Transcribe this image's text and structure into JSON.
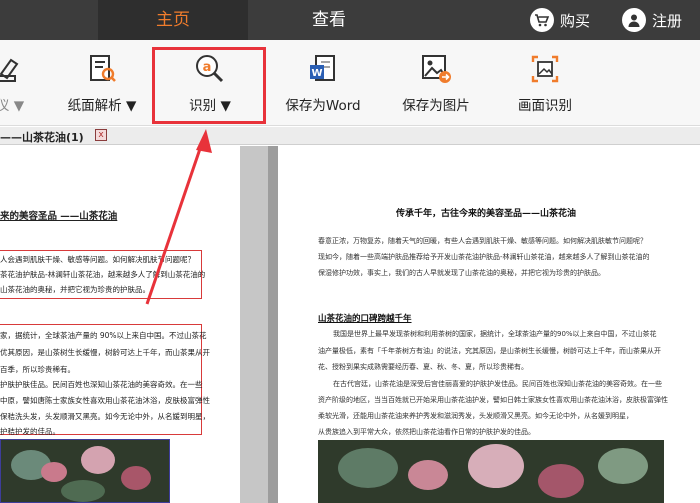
{
  "nav": {
    "tab_home": "主页",
    "tab_view": "查看",
    "buy": "购买",
    "register": "注册"
  },
  "toolbar": {
    "partial_left": "仪",
    "page_analysis": "纸面解析",
    "recognize": "识别",
    "save_word": "保存为Word",
    "save_image": "保存为图片",
    "screen_recognize": "画面识别"
  },
  "document": {
    "tab_name": "——山茶花油(1)",
    "close": "x"
  },
  "left_page": {
    "heading": "来的美容圣品 ——山茶花油",
    "lines": [
      "人会遇到肌肤干燥、敏感等问题。如何解决肌肤节问题呢？",
      "茶花油护肤品-林澜轩山茶花油，越来越多人了解到山茶花油的",
      "山茶花油的奥秘，并把它视为珍贵的护肤品。",
      "家，据统计，全球茶油产量的 90%以上来自中国。不过山茶花",
      "优其原因，是山茶树生长缓慢，树龄可达上千年，而山茶果从开",
      "百季，所以珍贵稀有。",
      "护肤护肤佳品。民间百姓也深知山茶花油的美容奇效。在一些",
      "中原，譬如唐陈士家族女性喜欢用山茶花油沐浴，皮肤极富弹性",
      "保秸洗头发，头发顺滑又黑亮。如今无论中外，从名媛到明星，",
      "护秸护发的佳品。"
    ]
  },
  "right_page": {
    "title": "传承千年，古往今来的美容圣品——山茶花油",
    "paragraph1": [
      "春意正浓，万物复苏，随着天气的回暖，有些人会遇到肌肤干燥、敏感等问题。如何解决肌肤敏节问题呢？",
      "现如今，随着一些高端护肤品推荐给予开发山茶花油护肤品-林澜轩山茶花油，越来越多人了解到山茶花油的",
      "保湿修护功效，事实上，我们的古人早就发现了山茶花油的奥秘，并把它视为珍贵的护肤品。"
    ],
    "section_heading": "山茶花油的口碑跨越千年",
    "paragraph2": [
      "我国是世界上最早发现茶树和利用茶树的国家，据统计，全球茶油产量的90%以上来自中国，不过山茶花",
      "油产量极低，素有「千年茶树方有油」的说法，究其原因，是山茶树生长缓慢，树龄可达上千年，而山茶果从开",
      "花、授粉到果实成熟需要经历春、夏、秋、冬、夏，所以珍贵稀有。",
      "在古代宫廷，山茶花油是深受后宫佳丽喜爱的护肤护发佳品。民间百姓也深知山茶花油的美容奇效。在一些",
      "资产阶级的地区，当当百姓就已开始采用山茶花油护发，譬如日韩士家族女性喜欢用山茶花油沐浴，皮肤极富弹性",
      "柔软光滑，还能用山茶花油来养护秀发和滋润秀发，头发顺滑又黑亮。如今无论中外，从名媛到明星，",
      "从贵族追入到平常大众，依然把山茶花油看作日常的护肤护发的佳品。"
    ]
  },
  "colors": {
    "accent_orange": "#f07c2c",
    "highlight_red": "#e8323a",
    "topbar": "#3c3c3c"
  },
  "icons": [
    "cart-icon",
    "user-icon",
    "scanner-icon",
    "page-analysis-icon",
    "ocr-icon",
    "word-icon",
    "image-icon",
    "screen-ocr-icon"
  ]
}
